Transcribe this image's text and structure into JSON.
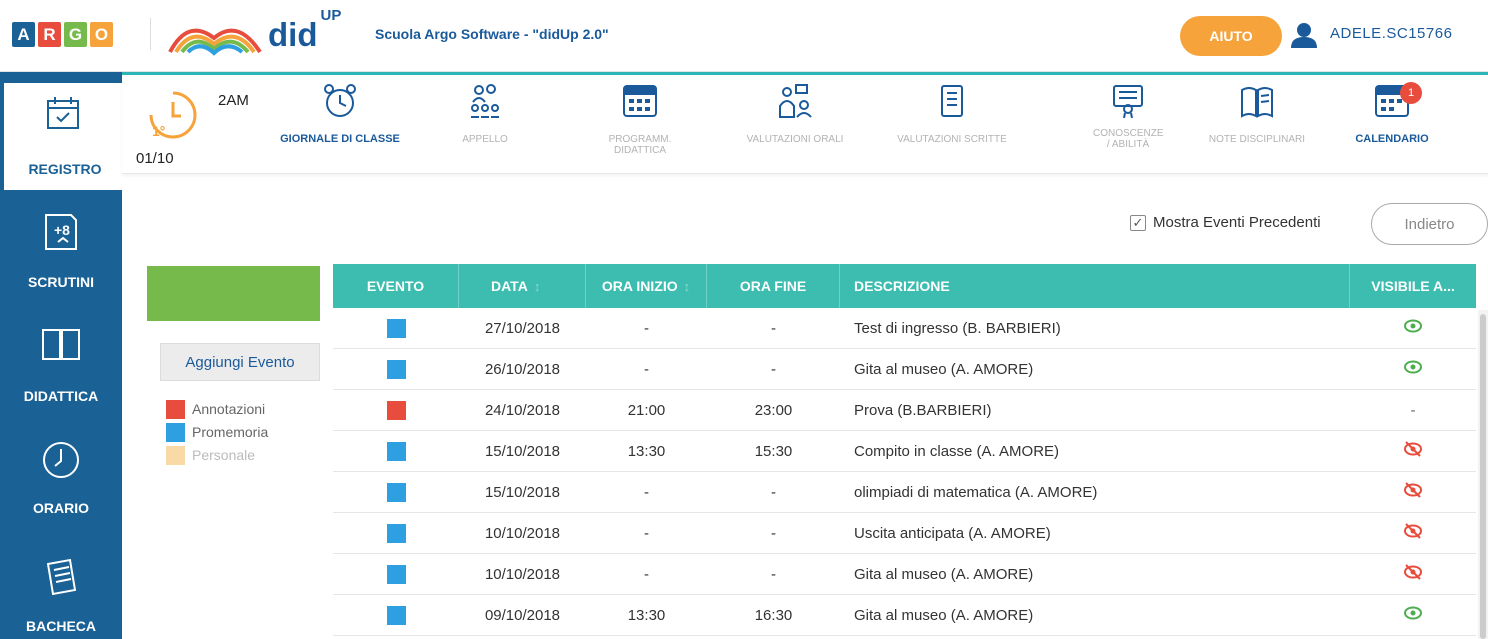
{
  "header": {
    "logo_letters": [
      "A",
      "R",
      "G",
      "O"
    ],
    "logo_colors": [
      "#1a6196",
      "#e74c3c",
      "#76ba4c",
      "#f6a33b"
    ],
    "app_name": "did",
    "app_sup": "UP",
    "school": "Scuola Argo Software - \"didUp 2.0\"",
    "help_label": "AIUTO",
    "username": "ADELE.SC15766"
  },
  "sidebar": {
    "items": [
      {
        "label": "REGISTRO",
        "icon": "calendar-check-icon"
      },
      {
        "label": "SCRUTINI",
        "icon": "plus-eight-icon"
      },
      {
        "label": "DIDATTICA",
        "icon": "book-icon"
      },
      {
        "label": "ORARIO",
        "icon": "clock-icon"
      },
      {
        "label": "BACHECA",
        "icon": "notes-icon"
      }
    ]
  },
  "toolbar": {
    "class_name": "2AM",
    "hour": "1°",
    "date": "01/10",
    "tools": [
      {
        "label": "GIORNALE DI CLASSE",
        "icon": "alarm-clock-icon",
        "active": true
      },
      {
        "label": "APPELLO",
        "icon": "people-icon",
        "active": false
      },
      {
        "label": "PROGRAMM. DIDATTICA",
        "icon": "planner-icon",
        "active": false
      },
      {
        "label": "VALUTAZIONI ORALI",
        "icon": "oral-eval-icon",
        "active": false
      },
      {
        "label": "VALUTAZIONI SCRITTE",
        "icon": "written-eval-icon",
        "active": false
      },
      {
        "label": "CONOSCENZE / ABILITÀ",
        "icon": "certificate-icon",
        "active": false
      },
      {
        "label": "NOTE DISCIPLINARI",
        "icon": "notebook-icon",
        "active": false
      },
      {
        "label": "CALENDARIO",
        "icon": "calendar-icon",
        "active": true,
        "badge": "1"
      }
    ]
  },
  "controls": {
    "show_previous_label": "Mostra Eventi Precedenti",
    "show_previous_checked": true,
    "back_label": "Indietro",
    "add_event_label": "Aggiungi Evento"
  },
  "legend": [
    {
      "label": "Annotazioni",
      "color": "#e74c3c"
    },
    {
      "label": "Promemoria",
      "color": "#2e9fe0"
    },
    {
      "label": "Personale",
      "color": "#f9d9a6"
    }
  ],
  "table": {
    "headers": [
      "EVENTO",
      "DATA",
      "ORA INIZIO",
      "ORA FINE",
      "DESCRIZIONE",
      "VISIBILE A..."
    ],
    "rows": [
      {
        "type": "Promemoria",
        "color": "#2e9fe0",
        "data": "27/10/2018",
        "inizio": "-",
        "fine": "-",
        "descrizione": "Test di ingresso (B. BARBIERI)",
        "visibile": "eye"
      },
      {
        "type": "Promemoria",
        "color": "#2e9fe0",
        "data": "26/10/2018",
        "inizio": "-",
        "fine": "-",
        "descrizione": "Gita al museo (A. AMORE)",
        "visibile": "eye"
      },
      {
        "type": "Annotazioni",
        "color": "#e74c3c",
        "data": "24/10/2018",
        "inizio": "21:00",
        "fine": "23:00",
        "descrizione": "Prova (B.BARBIERI)",
        "visibile": "-"
      },
      {
        "type": "Promemoria",
        "color": "#2e9fe0",
        "data": "15/10/2018",
        "inizio": "13:30",
        "fine": "15:30",
        "descrizione": "Compito in classe (A. AMORE)",
        "visibile": "eye-off"
      },
      {
        "type": "Promemoria",
        "color": "#2e9fe0",
        "data": "15/10/2018",
        "inizio": "-",
        "fine": "-",
        "descrizione": "olimpiadi di matematica (A. AMORE)",
        "visibile": "eye-off"
      },
      {
        "type": "Promemoria",
        "color": "#2e9fe0",
        "data": "10/10/2018",
        "inizio": "-",
        "fine": "-",
        "descrizione": "Uscita anticipata (A. AMORE)",
        "visibile": "eye-off"
      },
      {
        "type": "Promemoria",
        "color": "#2e9fe0",
        "data": "10/10/2018",
        "inizio": "-",
        "fine": "-",
        "descrizione": "Gita al museo (A. AMORE)",
        "visibile": "eye-off"
      },
      {
        "type": "Promemoria",
        "color": "#2e9fe0",
        "data": "09/10/2018",
        "inizio": "13:30",
        "fine": "16:30",
        "descrizione": "Gita al museo (A. AMORE)",
        "visibile": "eye"
      }
    ]
  }
}
